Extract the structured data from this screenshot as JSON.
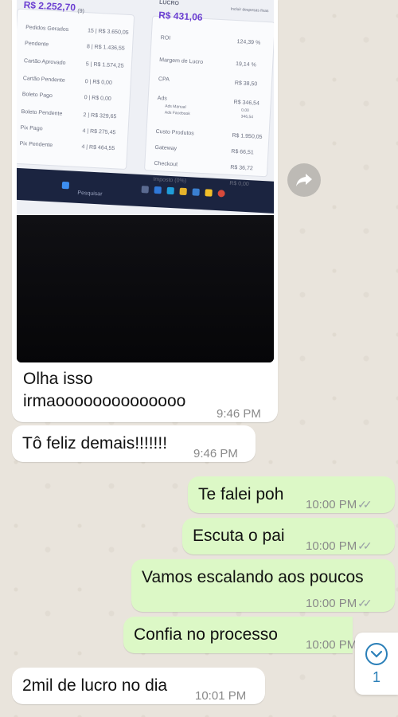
{
  "photo_message": {
    "screen": {
      "header_label": "LUCRO",
      "checkbox_label": "Incluir despesas fixas",
      "balance": "R$ 2.252,70",
      "balance_count": "(9)",
      "profit": "R$ 431,06",
      "left_rows": [
        {
          "label": "Pedidos Gerados",
          "value": "15 | R$ 3.650,05"
        },
        {
          "label": "Pendente",
          "value": "8 | R$ 1.436,55"
        },
        {
          "label": "Cartão Aprovado",
          "value": "5 | R$ 1.574,25"
        },
        {
          "label": "Cartão Pendente",
          "value": "0 | R$ 0,00"
        },
        {
          "label": "Boleto Pago",
          "value": "0 | R$ 0,00"
        },
        {
          "label": "Boleto Pendente",
          "value": "2 | R$ 329,65"
        },
        {
          "label": "Pix Pago",
          "value": "4 | R$ 275,45"
        },
        {
          "label": "Pix Pendente",
          "value": "4 | R$ 464,55"
        }
      ],
      "right_rows": [
        {
          "label": "ROI",
          "value": "124,39 %"
        },
        {
          "label": "Margem de Lucro",
          "value": "19,14 %"
        },
        {
          "label": "CPA",
          "value": "R$ 38,50"
        },
        {
          "label": "Ads",
          "value": "R$ 346,54"
        },
        {
          "label": "Ads Manual",
          "value": "0,00"
        },
        {
          "label": "Ads Facebook",
          "value": "346,54"
        },
        {
          "label": "Custo Produtos",
          "value": "R$ 1.950,05"
        },
        {
          "label": "Gateway",
          "value": "R$ 66,51"
        },
        {
          "label": "Checkout",
          "value": "R$ 36,72"
        },
        {
          "label": "Imposto (0%)",
          "value": "R$ 0,00"
        }
      ],
      "search_label": "Pesquisar"
    },
    "caption": "Olha isso\nirmaoooooooooooooo",
    "time": "9:46 PM"
  },
  "messages": [
    {
      "text": "Tô feliz demais!!!!!!!",
      "time": "9:46 PM",
      "direction": "in"
    },
    {
      "text": "Te falei poh",
      "time": "10:00 PM",
      "direction": "out",
      "read": true
    },
    {
      "text": "Escuta o pai",
      "time": "10:00 PM",
      "direction": "out",
      "read": true
    },
    {
      "text": "Vamos escalando aos poucos",
      "time": "10:00 PM",
      "direction": "out",
      "read": true
    },
    {
      "text": "Confia no processo",
      "time": "10:00 PM",
      "direction": "out",
      "read": true
    },
    {
      "text": "2mil de lucro no dia",
      "time": "10:01 PM",
      "direction": "in"
    }
  ],
  "scroll_button": {
    "icon": "chevron-down-icon",
    "unread_count": "1"
  },
  "forward_button": {
    "icon": "forward-arrow-icon"
  },
  "colors": {
    "incoming": "#ffffff",
    "outgoing": "#dcf8c6",
    "wallpaper": "#e9e4dc",
    "accent": "#2a7fb8"
  }
}
